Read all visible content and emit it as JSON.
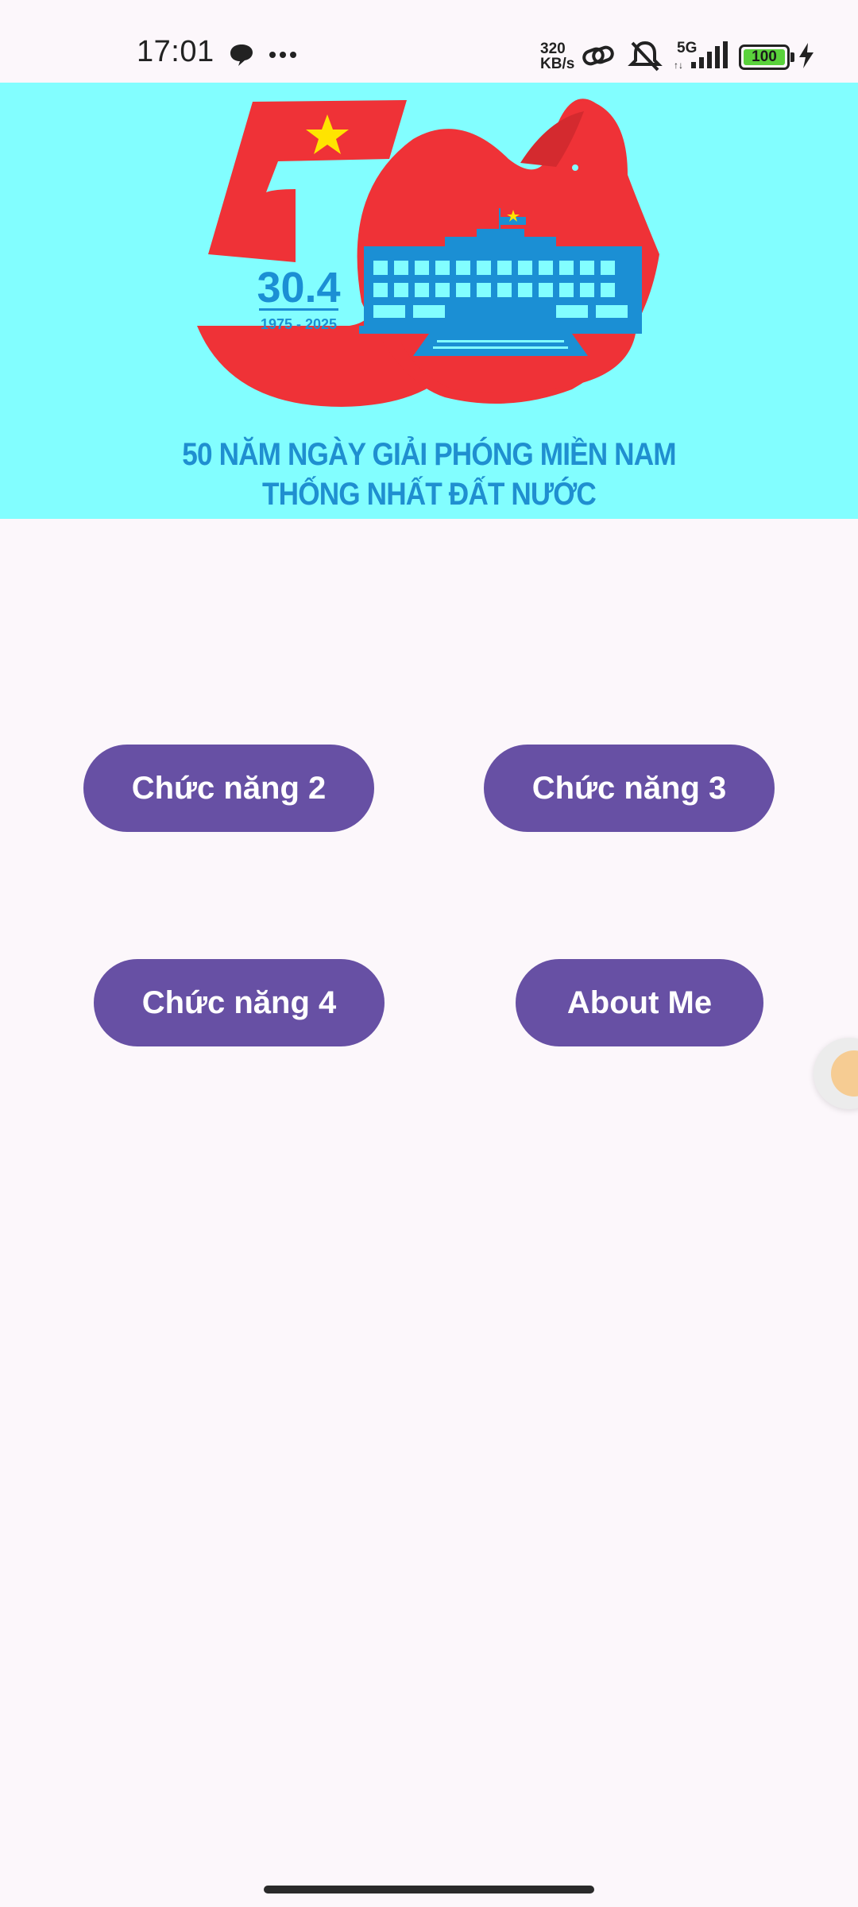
{
  "status_bar": {
    "time": "17:01",
    "speed_value": "320",
    "speed_unit": "KB/s",
    "network": "5G",
    "battery": "100"
  },
  "banner": {
    "badge_date": "30.4",
    "badge_years": "1975 - 2025",
    "line1": "50 NĂM NGÀY GIẢI PHÓNG MIỀN NAM",
    "line2": "THỐNG NHẤT ĐẤT NƯỚC"
  },
  "buttons": {
    "b2": "Chức năng 2",
    "b3": "Chức năng 3",
    "b4": "Chức năng 4",
    "b5": "About Me"
  }
}
